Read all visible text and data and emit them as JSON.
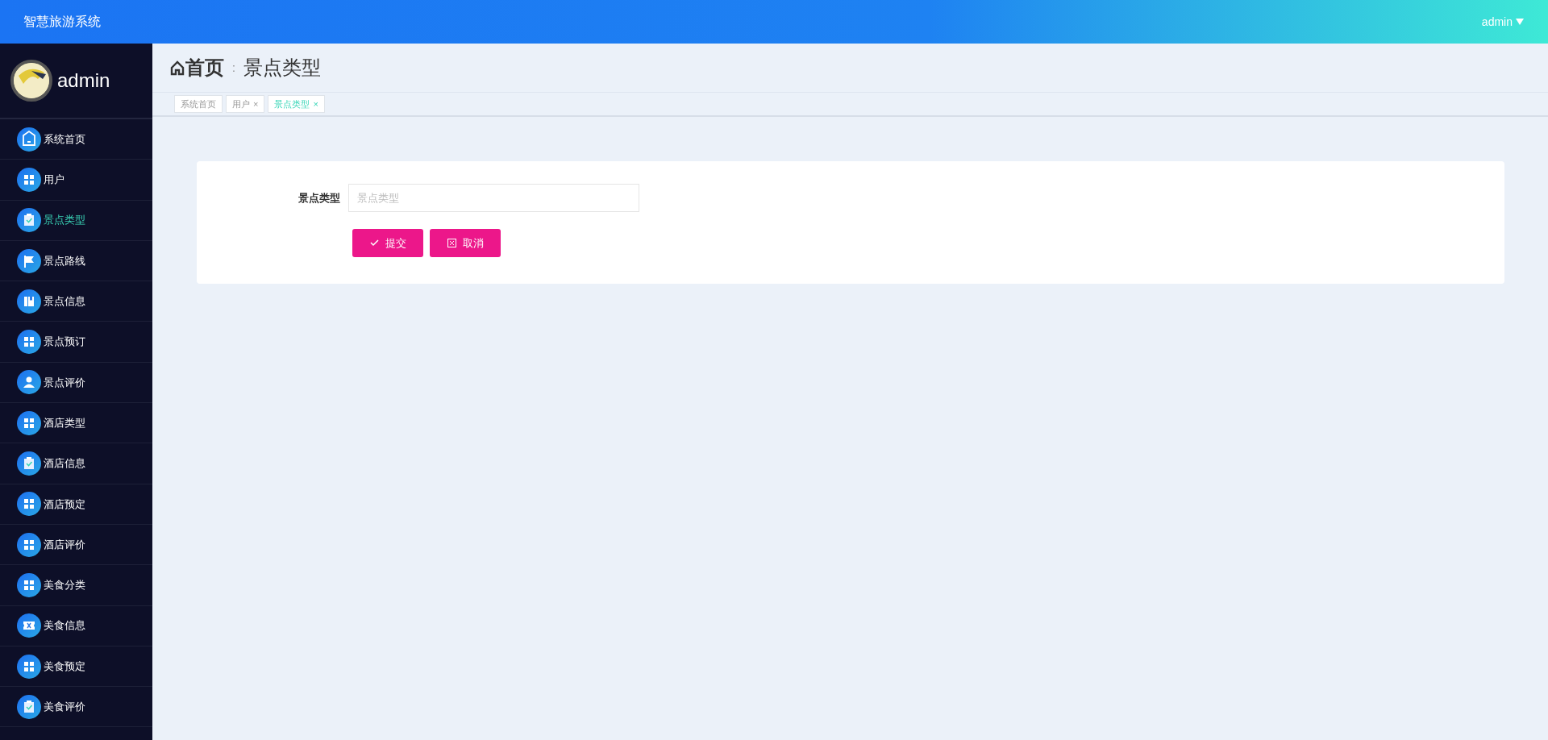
{
  "header": {
    "title": "智慧旅游系统",
    "user_menu": "admin"
  },
  "sidebar": {
    "user": "admin",
    "items": [
      {
        "label": "系统首页",
        "kind": "home",
        "selected": false
      },
      {
        "label": "用户",
        "kind": "grid",
        "selected": false
      },
      {
        "label": "景点类型",
        "kind": "clipboard",
        "selected": true
      },
      {
        "label": "景点路线",
        "kind": "flag",
        "selected": false
      },
      {
        "label": "景点信息",
        "kind": "book",
        "selected": false
      },
      {
        "label": "景点预订",
        "kind": "grid",
        "selected": false
      },
      {
        "label": "景点评价",
        "kind": "user",
        "selected": false
      },
      {
        "label": "酒店类型",
        "kind": "grid",
        "selected": false
      },
      {
        "label": "酒店信息",
        "kind": "clipboard",
        "selected": false
      },
      {
        "label": "酒店预定",
        "kind": "grid",
        "selected": false
      },
      {
        "label": "酒店评价",
        "kind": "grid",
        "selected": false
      },
      {
        "label": "美食分类",
        "kind": "grid",
        "selected": false
      },
      {
        "label": "美食信息",
        "kind": "ticket",
        "selected": false
      },
      {
        "label": "美食预定",
        "kind": "grid",
        "selected": false
      },
      {
        "label": "美食评价",
        "kind": "clipboard",
        "selected": false
      }
    ]
  },
  "breadcrumb": {
    "home": "首页",
    "separator": ":",
    "current": "景点类型"
  },
  "tabs": [
    {
      "label": "系统首页",
      "selected": false
    },
    {
      "label": "用户",
      "close": "×",
      "selected": false
    },
    {
      "label": "景点类型",
      "close": "×",
      "selected": true
    }
  ],
  "form": {
    "field": {
      "label": "景点类型",
      "placeholder": "景点类型"
    },
    "buttons": [
      {
        "label": "提交",
        "kind": "submit"
      },
      {
        "label": "取消",
        "kind": "cancel"
      }
    ]
  }
}
